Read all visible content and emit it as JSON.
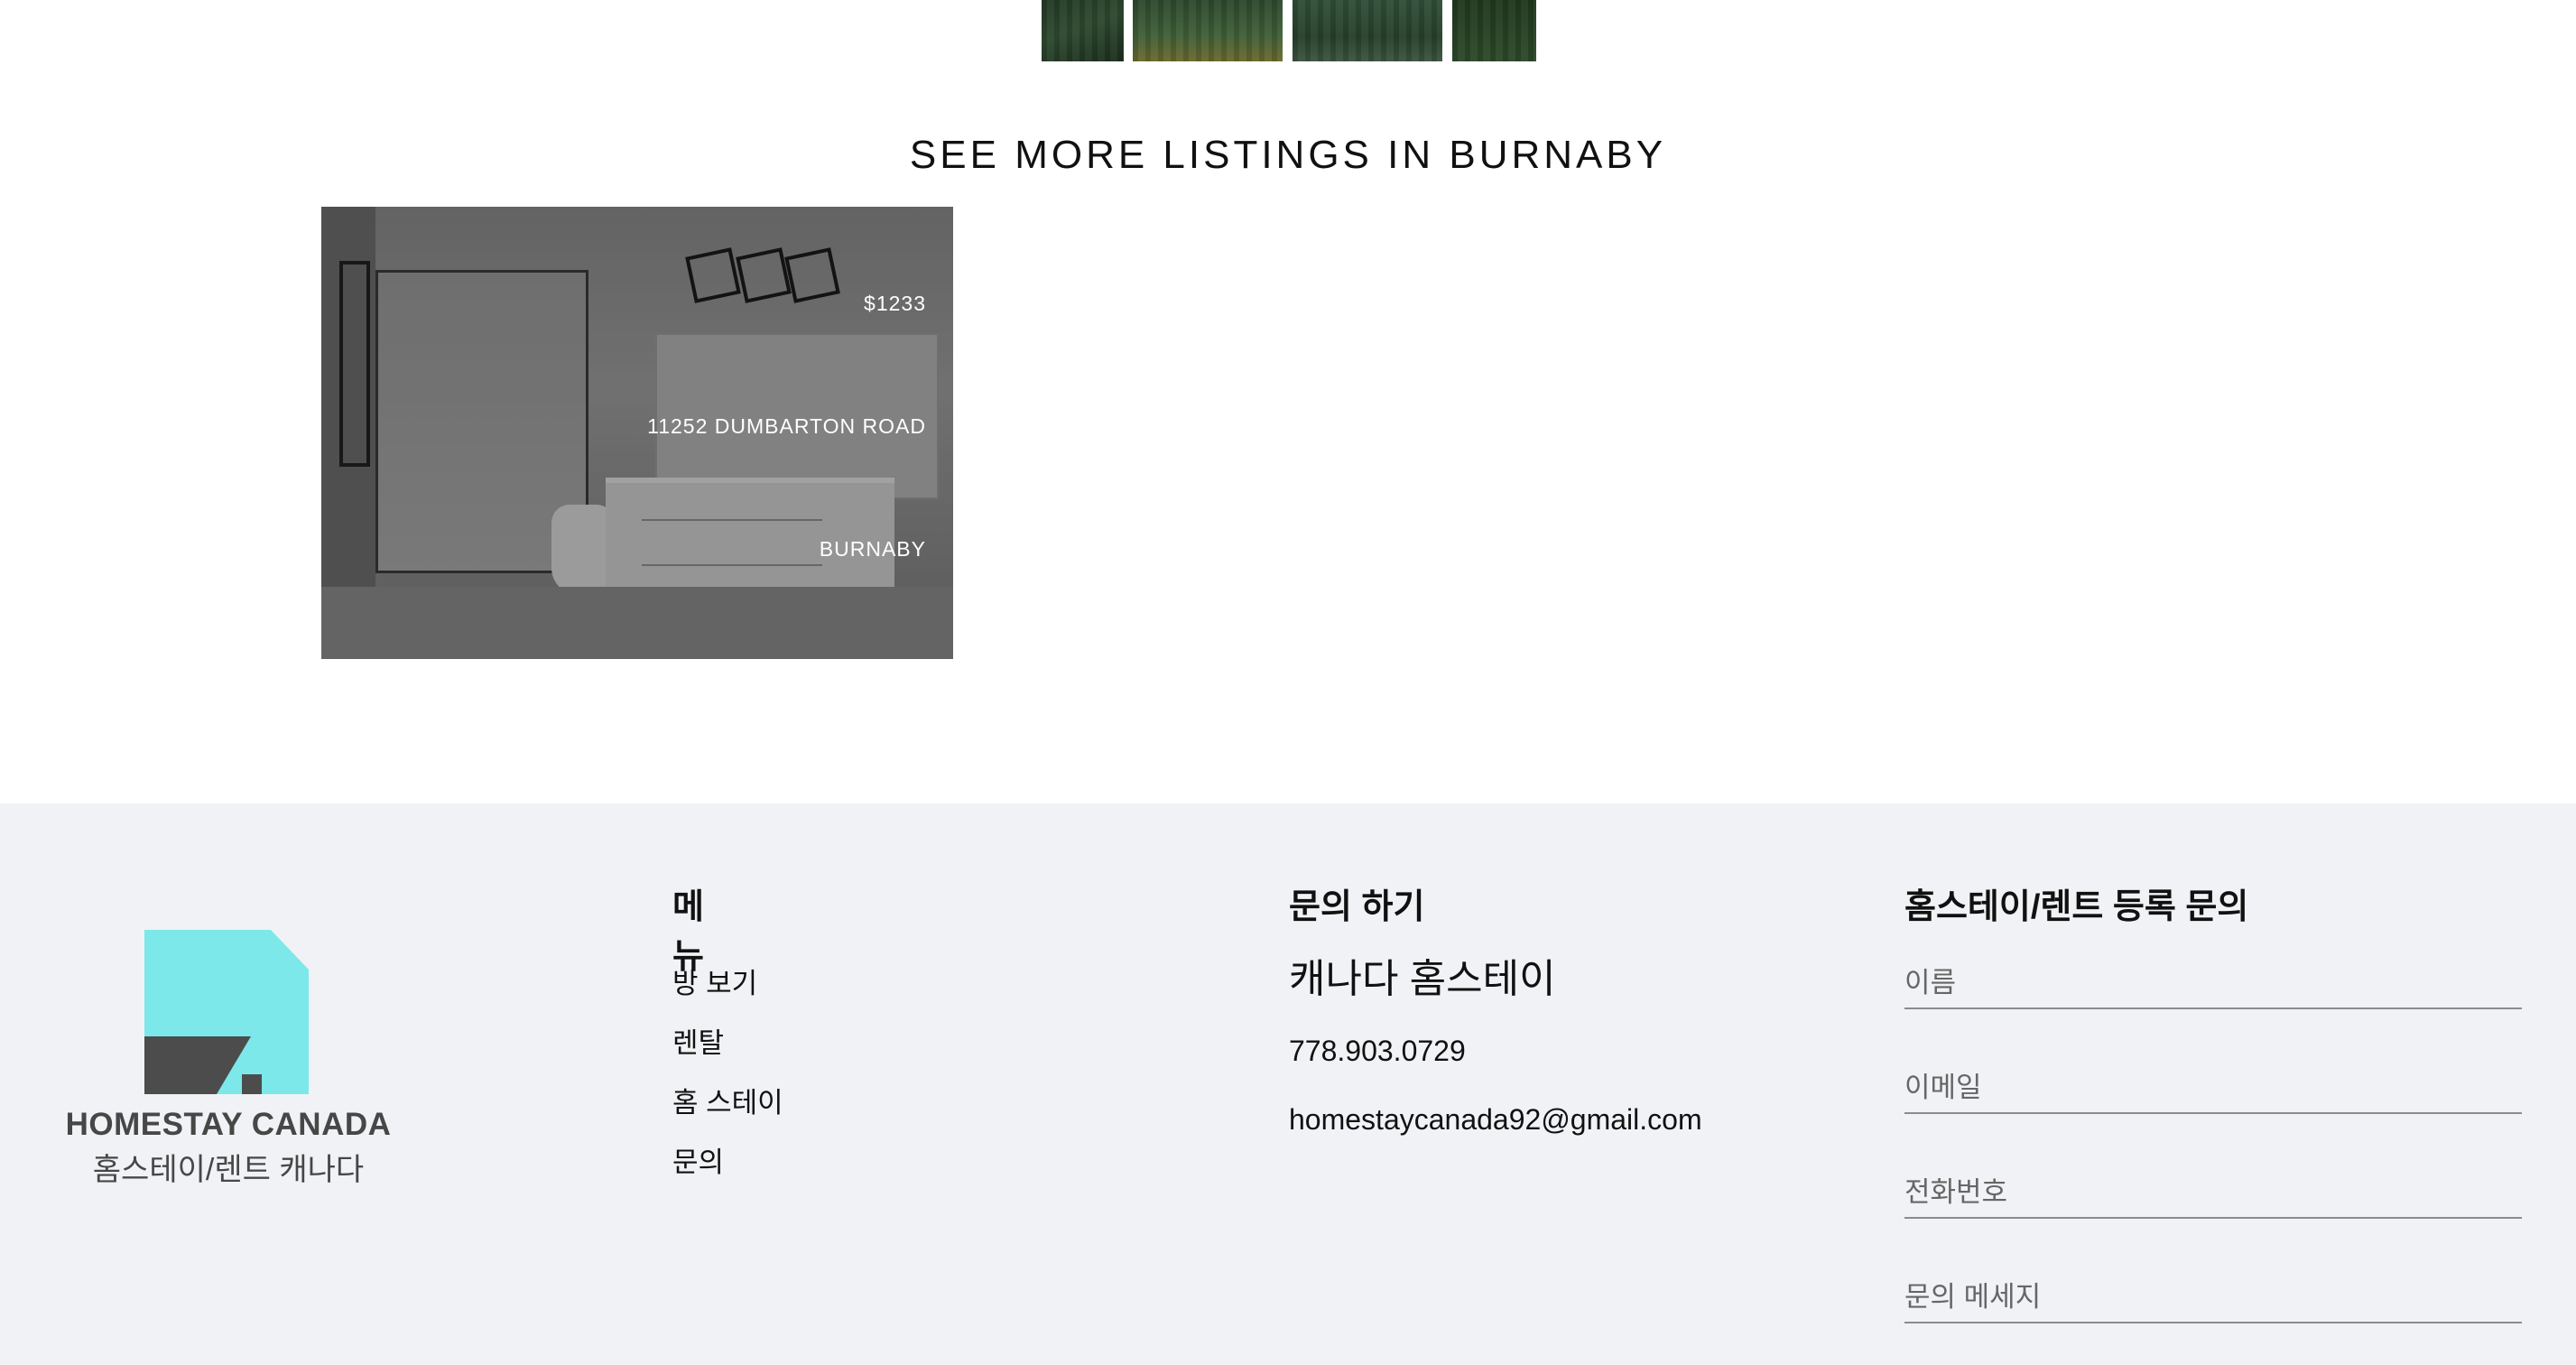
{
  "listings_section": {
    "heading": "SEE MORE LISTINGS IN BURNABY",
    "listings": [
      {
        "price": "$1233",
        "address": "11252 DUMBARTON ROAD",
        "city": "BURNABY"
      }
    ]
  },
  "footer": {
    "logo": {
      "brand": "HOMESTAY CANADA",
      "subtitle": "홈스테이/렌트 캐나다",
      "accent_color": "#7de8ea",
      "roof_color": "#4c4c4c"
    },
    "menu": {
      "title": "메뉴",
      "items": [
        "방 보기",
        "렌탈",
        "홈 스테이",
        "문의"
      ]
    },
    "contact": {
      "title": "문의 하기",
      "org": "캐나다 홈스테이",
      "phone": "778.903.0729",
      "email": "homestaycanada92@gmail.com"
    },
    "form": {
      "title": "홈스테이/렌트 등록 문의",
      "name_placeholder": "이름",
      "email_placeholder": "이메일",
      "phone_placeholder": "전화번호",
      "message_placeholder": "문의 메세지"
    }
  },
  "colors": {
    "footer_bg": "#f1f2f5",
    "text": "#111111"
  }
}
